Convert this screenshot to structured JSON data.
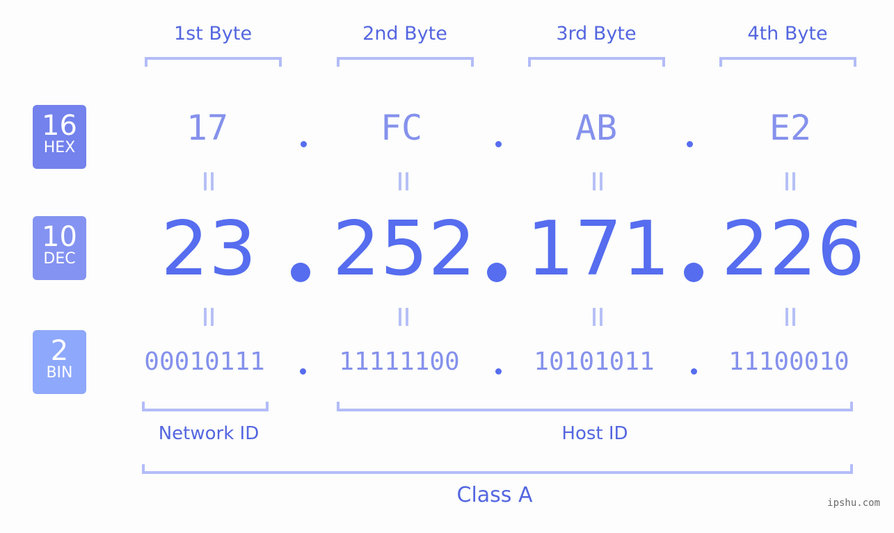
{
  "byte_headers": [
    "1st Byte",
    "2nd Byte",
    "3rd Byte",
    "4th Byte"
  ],
  "badges": [
    {
      "num": "16",
      "label": "HEX",
      "color": "#7382ec"
    },
    {
      "num": "10",
      "label": "DEC",
      "color": "#8493f1"
    },
    {
      "num": "2",
      "label": "BIN",
      "color": "#8ea8fb"
    }
  ],
  "hex": [
    "17",
    "FC",
    "AB",
    "E2"
  ],
  "dec": [
    "23",
    "252",
    "171",
    "226"
  ],
  "bin": [
    "00010111",
    "11111100",
    "10101011",
    "11100010"
  ],
  "sections": {
    "network_id": "Network ID",
    "host_id": "Host ID",
    "class": "Class A"
  },
  "watermark": "ipshu.com",
  "colors": {
    "accent": "#566def",
    "label": "#5466e0",
    "light": "#8591ec",
    "bracket": "#b3bcf8"
  }
}
